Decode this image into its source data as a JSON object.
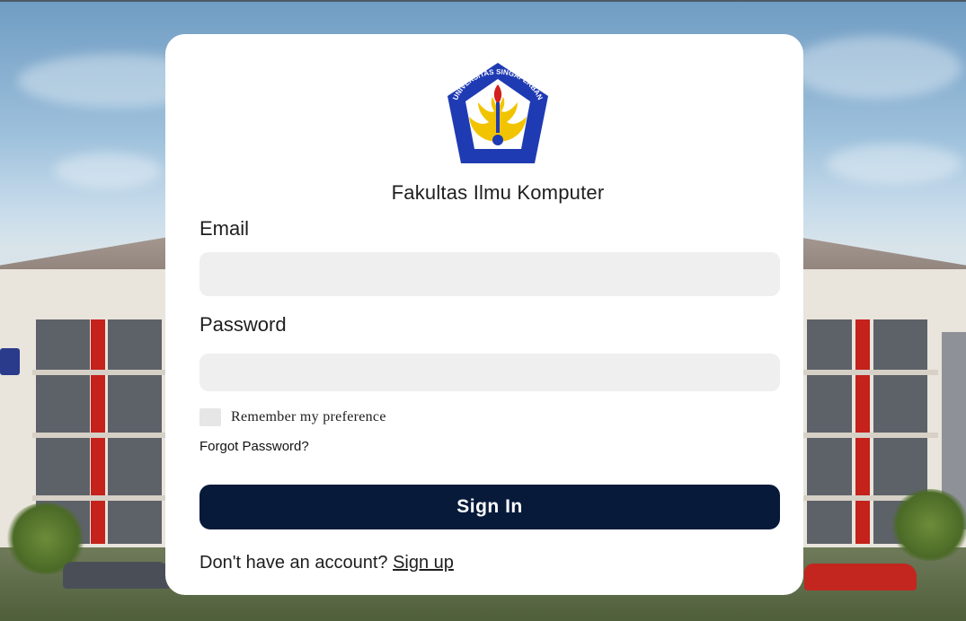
{
  "colors": {
    "primary_button": "#071a3a",
    "input_background": "#efefef",
    "card_background": "#ffffff",
    "logo_blue": "#1f3bb3",
    "logo_yellow": "#f2c400"
  },
  "logo": {
    "icon": "university-crest-icon",
    "text": "UNIVERSITAS SINGAPERBANGSA KARAWANG"
  },
  "faculty_name": "Fakultas Ilmu Komputer",
  "form": {
    "email_label": "Email",
    "email_value": "",
    "email_placeholder": "",
    "password_label": "Password",
    "password_value": "",
    "password_placeholder": "",
    "remember_label": "Remember my preference",
    "remember_checked": false,
    "forgot_label": "Forgot Password?",
    "submit_label": "Sign In"
  },
  "signup": {
    "prompt": "Don't have an account?",
    "link_label": "Sign up"
  }
}
